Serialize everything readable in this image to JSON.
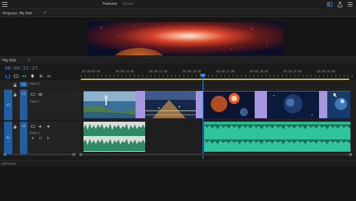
{
  "topbar": {
    "tabs": [
      {
        "label": "Features",
        "active": true
      },
      {
        "label": "Edited",
        "active": false
      }
    ],
    "icons": [
      "share-icon",
      "export-icon",
      "menu-icon"
    ]
  },
  "program_monitor": {
    "title": "Program: My Edit",
    "menu": "≡"
  },
  "timeline": {
    "title": "My Edit",
    "close": "×",
    "menu": "≡",
    "timecode": "00:00:21:27",
    "ruler_labels": [
      "00:00:05:00",
      "00:00:10:00",
      "00:00:15:00",
      "00:00:20:00",
      "00:00:25:00",
      "00:00:30:00",
      "00:00:35:00",
      "00:00:40:00"
    ],
    "tracks": {
      "v2": {
        "src": "",
        "target": "V2",
        "name": "Video 2"
      },
      "v1": {
        "src": "V1",
        "target": "V1",
        "name": "Video 1"
      },
      "a1": {
        "src": "A1",
        "target": "A1",
        "name": "Audio 1"
      }
    }
  },
  "bottom_panel": {
    "label": "eyframe"
  },
  "colors": {
    "accent": "#2e8ff0",
    "work_area": "#d6c52a",
    "transition": "#a796e0",
    "audio_clip": "#2fc49a",
    "audio_clip_light": "#d9dcd9",
    "track_target": "#1f5fa8"
  }
}
